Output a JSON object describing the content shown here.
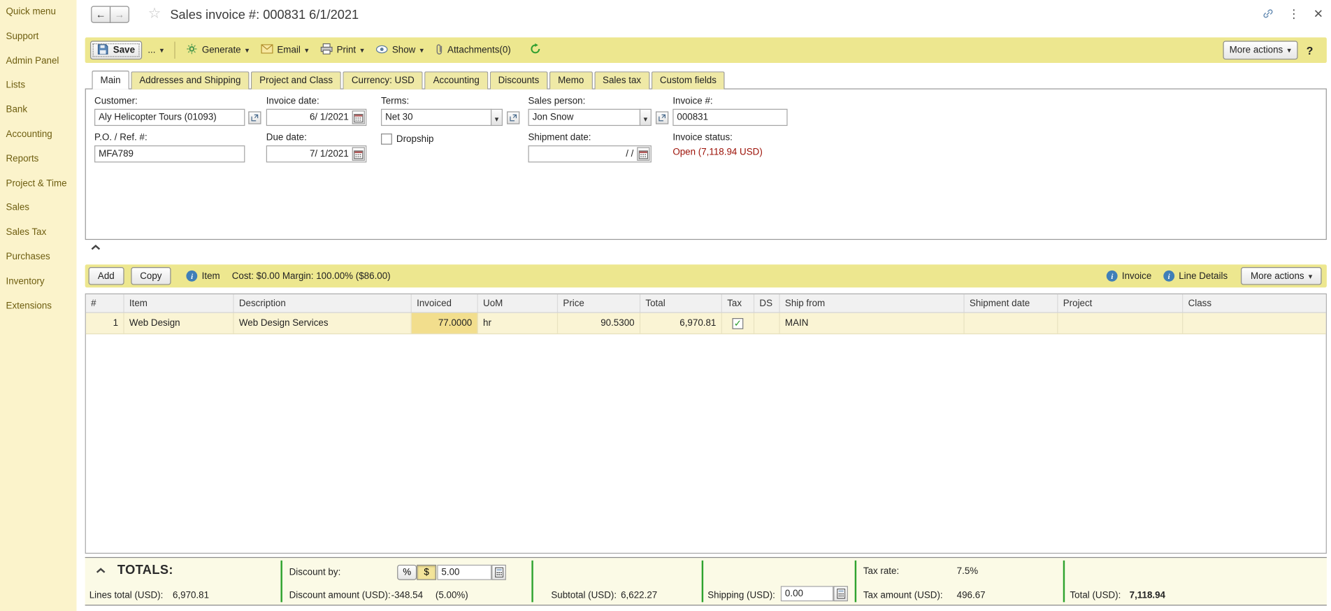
{
  "colors": {
    "sidebar-bg": "#FBF3CB",
    "bar-bg": "#EDE78F",
    "row-yellow": "#FAF4D4",
    "hl-yellow": "#F2DE8D",
    "green": "#2FA32F",
    "status-red": "#9C1006"
  },
  "header": {
    "title": "Sales invoice #: 000831 6/1/2021"
  },
  "sidebar": {
    "items": [
      {
        "label": "Quick menu"
      },
      {
        "label": "Support"
      },
      {
        "label": "Admin Panel"
      },
      {
        "label": "Lists"
      },
      {
        "label": "Bank"
      },
      {
        "label": "Accounting"
      },
      {
        "label": "Reports"
      },
      {
        "label": "Project & Time"
      },
      {
        "label": "Sales"
      },
      {
        "label": "Sales Tax"
      },
      {
        "label": "Purchases"
      },
      {
        "label": "Inventory"
      },
      {
        "label": "Extensions"
      }
    ]
  },
  "toolbar": {
    "save": "Save",
    "dots": "...",
    "generate": "Generate",
    "email": "Email",
    "print": "Print",
    "show": "Show",
    "attachments": "Attachments(0)",
    "more_actions": "More actions",
    "help": "?"
  },
  "tabs": [
    {
      "label": "Main"
    },
    {
      "label": "Addresses and Shipping"
    },
    {
      "label": "Project and Class"
    },
    {
      "label": "Currency: USD"
    },
    {
      "label": "Accounting"
    },
    {
      "label": "Discounts"
    },
    {
      "label": "Memo"
    },
    {
      "label": "Sales tax"
    },
    {
      "label": "Custom fields"
    }
  ],
  "form": {
    "customer_label": "Customer:",
    "customer_value": "Aly Helicopter Tours (01093)",
    "invoice_date_label": "Invoice date:",
    "invoice_date_value": "6/ 1/2021",
    "terms_label": "Terms:",
    "terms_value": "Net 30",
    "sales_person_label": "Sales person:",
    "sales_person_value": "Jon Snow",
    "invoice_no_label": "Invoice #:",
    "invoice_no_value": "000831",
    "po_label": "P.O. / Ref. #:",
    "po_value": "MFA789",
    "due_date_label": "Due date:",
    "due_date_value": "7/ 1/2021",
    "dropship_label": "Dropship",
    "shipment_date_label": "Shipment date:",
    "shipment_date_value": "/ /",
    "status_label": "Invoice status:",
    "status_value": "Open (7,118.94 USD)"
  },
  "items_bar": {
    "add": "Add",
    "copy": "Copy",
    "item": "Item",
    "cost_info": "Cost: $0.00 Margin: 100.00% ($86.00)",
    "invoice": "Invoice",
    "line_details": "Line Details",
    "more_actions": "More actions"
  },
  "table": {
    "columns": [
      "#",
      "Item",
      "Description",
      "Invoiced",
      "UoM",
      "Price",
      "Total",
      "Tax",
      "DS",
      "Ship from",
      "Shipment date",
      "Project",
      "Class"
    ],
    "rows": [
      {
        "num": "1",
        "item": "Web Design",
        "description": "Web Design Services",
        "invoiced": "77.0000",
        "uom": "hr",
        "price": "90.5300",
        "total": "6,970.81",
        "tax_checked": true,
        "ds": "",
        "ship_from": "MAIN",
        "shipment_date": "",
        "project": "",
        "class": ""
      }
    ]
  },
  "totals": {
    "title": "TOTALS:",
    "lines_total_label": "Lines total (USD):",
    "lines_total_value": "6,970.81",
    "discount_by_label": "Discount by:",
    "percent_btn": "%",
    "dollar_btn": "$",
    "discount_input": "5.00",
    "discount_amount_label": "Discount amount (USD):",
    "discount_amount_value": "-348.54",
    "discount_amount_pct": "(5.00%)",
    "subtotal_label": "Subtotal (USD):",
    "subtotal_value": "6,622.27",
    "shipping_label": "Shipping (USD):",
    "shipping_input": "0.00",
    "tax_rate_label": "Tax rate:",
    "tax_rate_value": "7.5%",
    "tax_amount_label": "Tax amount (USD):",
    "tax_amount_value": "496.67",
    "total_label": "Total (USD):",
    "total_value": "7,118.94"
  }
}
